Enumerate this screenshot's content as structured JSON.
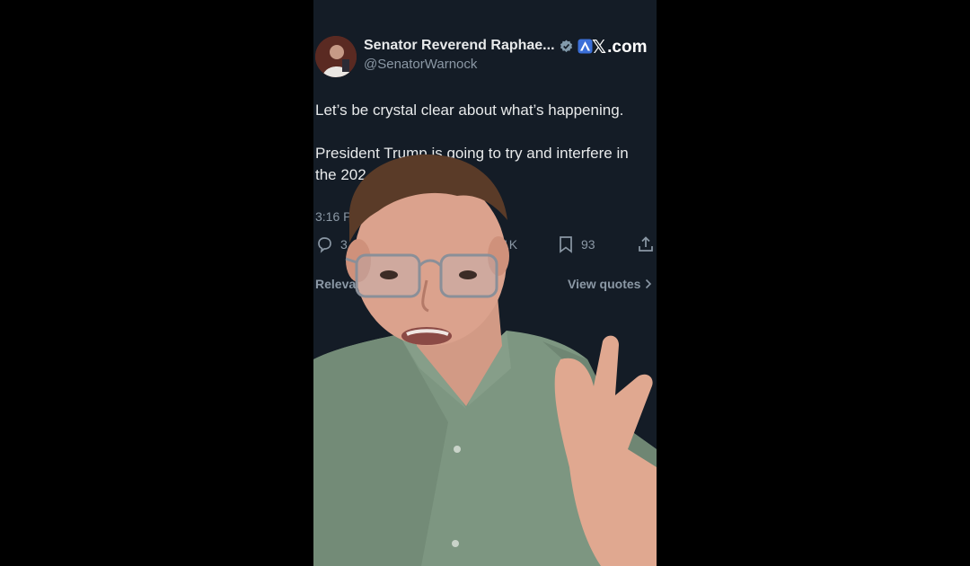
{
  "tweet": {
    "display_name": "Senator Reverend Raphae...",
    "handle": "@SenatorWarnock",
    "brand": "X.com",
    "brand_glyph": "𝕏",
    "brand_suffix": ".com",
    "lines": [
      "Let’s be crystal clear about what’s happening.",
      "President Trump is going to try and interfere in the 202"
    ],
    "timestamp": "3:16 P",
    "reply_count": "3",
    "like_count": "1K",
    "bookmark_count": "93",
    "footer_left": "Releva",
    "footer_right": "View quotes"
  },
  "icons": {
    "verified": "verified-badge-icon",
    "affiliate": "affiliate-badge-icon",
    "reply": "reply-icon",
    "bookmark": "bookmark-icon",
    "share": "share-icon",
    "chevron": "chevron-right-icon"
  },
  "colors": {
    "background": "#141c26",
    "text": "#e7e9ea",
    "muted": "#8b98a5",
    "shirt": "#7d9681"
  }
}
